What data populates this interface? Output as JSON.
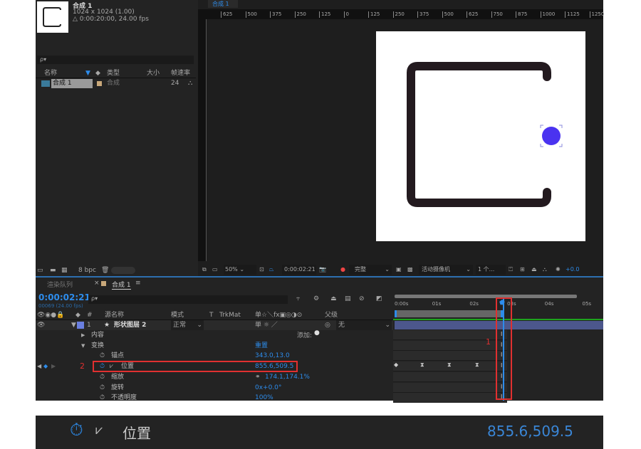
{
  "project": {
    "comp_name": "合成 1",
    "dimensions": "1024 x 1024 (1.00)",
    "duration": "△ 0:00:20:00, 24.00 fps",
    "search_placeholder": "ρ▾",
    "columns": [
      "名称",
      "类型",
      "大小",
      "帧速率"
    ],
    "items": [
      {
        "name": "合成 1",
        "type": "合成",
        "size": "",
        "fps": "24"
      }
    ],
    "bpc": "8 bpc"
  },
  "viewer": {
    "tab": "合成 1",
    "ruler": [
      "625",
      "500",
      "375",
      "250",
      "125",
      "0",
      "125",
      "250",
      "375",
      "500",
      "625",
      "750",
      "875",
      "1000",
      "1125",
      "1250"
    ],
    "zoom": "50%",
    "timecode": "0:00:02:21",
    "quality": "完整",
    "camera": "活动摄像机",
    "views": "1 个...",
    "exposure": "+0.0",
    "shape_color": "#231a1f",
    "circle_color": "#4a33f0"
  },
  "timeline": {
    "tabs": [
      "渲染队列",
      "合成 1"
    ],
    "current_time": "0:00:02:21",
    "frame_info": "00069 (24.00 fps)",
    "headers": {
      "num": "#",
      "source": "源名称",
      "mode": "模式",
      "t": "T",
      "trkmat": "TrkMat",
      "switches": "单☆＼fx▣◎◑⊙",
      "parent": "父级"
    },
    "layer": {
      "index": "1",
      "name": "形状图层 2",
      "mode": "正常",
      "parent": "无"
    },
    "add_label": "添加:",
    "properties": [
      {
        "label": "内容",
        "value": ""
      },
      {
        "label": "变换",
        "value": "重置"
      },
      {
        "label": "锚点",
        "value": "343.0,13.0"
      },
      {
        "label": "位置",
        "value": "855.6,509.5"
      },
      {
        "label": "缩放",
        "value": "174.1,174.1%"
      },
      {
        "label": "旋转",
        "value": "0x+0.0°"
      },
      {
        "label": "不透明度",
        "value": "100%"
      }
    ],
    "ruler": [
      "0:00s",
      "01s",
      "02s",
      "03s",
      "04s",
      "05s"
    ],
    "annotations": {
      "left": "2",
      "right": "1"
    },
    "accent": "#2d8ceb",
    "highlight": "#e03030"
  },
  "zoom_strip": {
    "label": "位置",
    "value": "855.6,509.5"
  }
}
